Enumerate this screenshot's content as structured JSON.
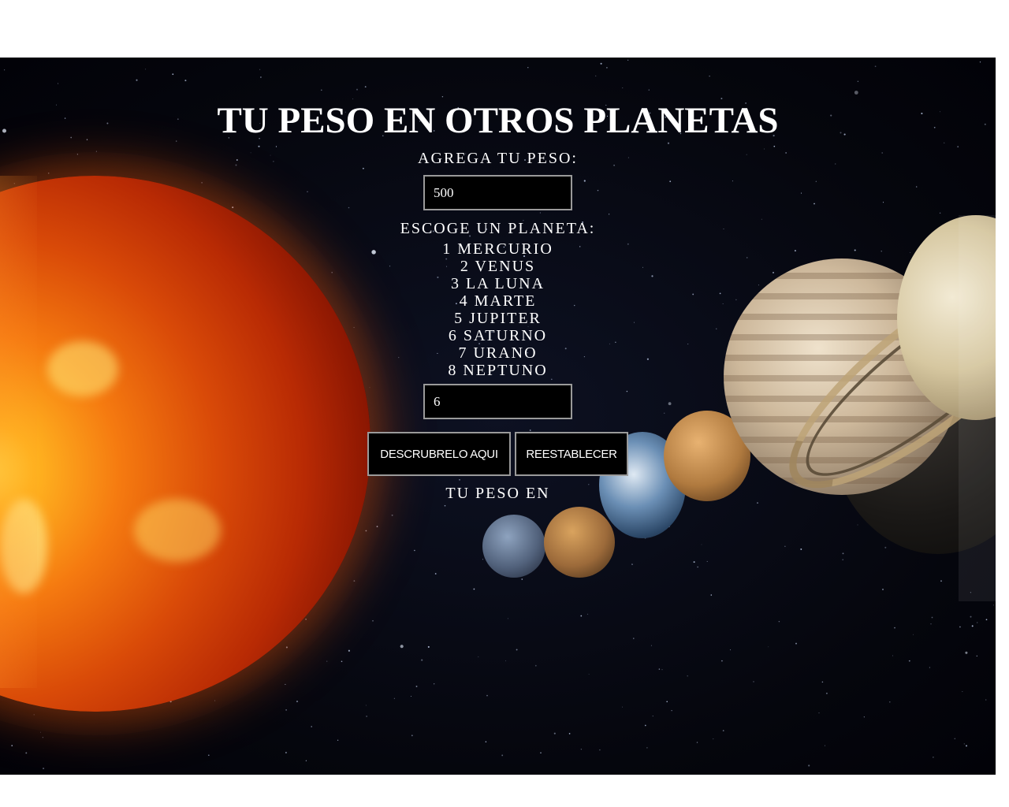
{
  "header": {
    "title": "TU PESO EN OTROS PLANETAS"
  },
  "weight": {
    "label": "AGREGA TU PESO:",
    "value": "500"
  },
  "planet_choice": {
    "label": "ESCOGE UN PLANETA:",
    "options": [
      "1 MERCURIO",
      "2 VENUS",
      "3 LA LUNA",
      "4 MARTE",
      "5 JUPITER",
      "6 SATURNO",
      "7 URANO",
      "8 NEPTUNO"
    ],
    "value": "6"
  },
  "buttons": {
    "discover": "DESCRUBRELO AQUI",
    "reset": "REESTABLECER"
  },
  "result": {
    "text": "TU PESO EN"
  },
  "colors": {
    "background": "#05060d",
    "text": "#ffffff",
    "field_background": "#000000",
    "field_border": "#9a9a9a"
  }
}
